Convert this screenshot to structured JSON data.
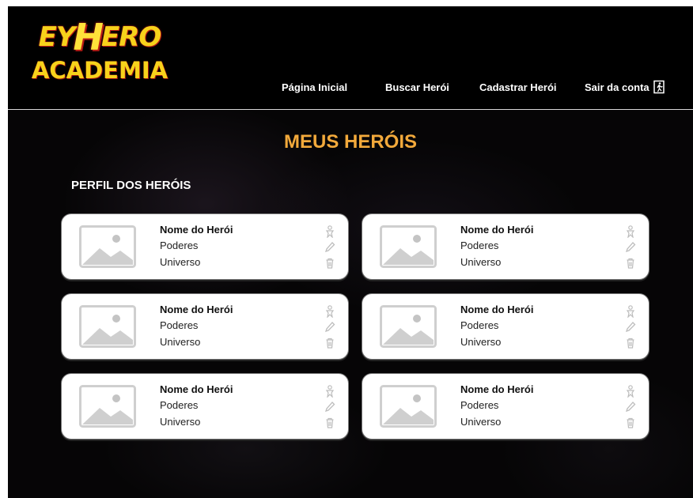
{
  "brand": {
    "logo_line1_a": "EY",
    "logo_line1_b": "H",
    "logo_line1_c": "ERO",
    "logo_line2": "ACADEMIA"
  },
  "nav": {
    "home": "Página Inicial",
    "search": "Buscar Herói",
    "register": "Cadastrar Herói",
    "logout": "Sair da conta"
  },
  "page": {
    "title": "MEUS HERÓIS",
    "section": "PERFIL DOS HERÓIS"
  },
  "heroes": [
    {
      "name": "Nome do Herói",
      "powers": "Poderes",
      "universe": "Universo"
    },
    {
      "name": "Nome do Herói",
      "powers": "Poderes",
      "universe": "Universo"
    },
    {
      "name": "Nome do Herói",
      "powers": "Poderes",
      "universe": "Universo"
    },
    {
      "name": "Nome do Herói",
      "powers": "Poderes",
      "universe": "Universo"
    },
    {
      "name": "Nome do Herói",
      "powers": "Poderes",
      "universe": "Universo"
    },
    {
      "name": "Nome do Herói",
      "powers": "Poderes",
      "universe": "Universo"
    }
  ],
  "icons": {
    "profile": "hero-profile-icon",
    "edit": "pencil-icon",
    "delete": "trash-icon",
    "placeholder": "image-placeholder-icon",
    "logout": "exit-door-icon"
  },
  "colors": {
    "title_accent": "#f2a93b",
    "logo_yellow": "#f7d21b",
    "logo_red": "#d2241c"
  }
}
